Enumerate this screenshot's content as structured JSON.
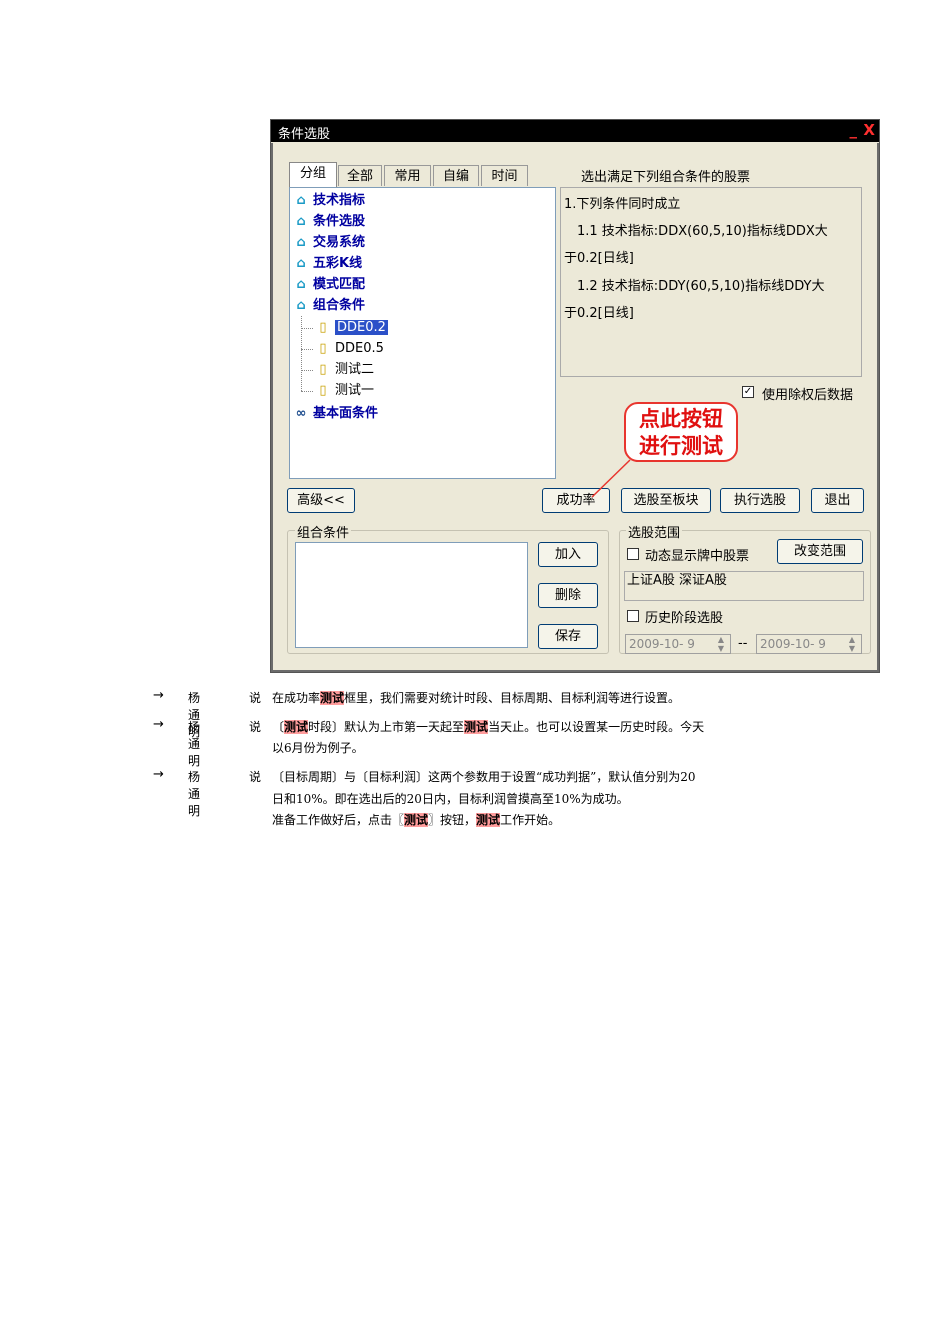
{
  "window": {
    "title": "条件选股",
    "minimize": "_",
    "close": "X"
  },
  "tabs": [
    "分组",
    "全部",
    "常用",
    "自编",
    "时间"
  ],
  "tree": {
    "roots": [
      "技术指标",
      "条件选股",
      "交易系统",
      "五彩K线",
      "模式匹配",
      "组合条件"
    ],
    "children": [
      "DDE0.2",
      "DDE0.5",
      "测试二",
      "测试一"
    ],
    "last_root": "基本面条件"
  },
  "conditions": {
    "title": "选出满足下列组合条件的股票",
    "lines": [
      "1.下列条件同时成立",
      "1.1 技术指标:DDX(60,5,10)指标线DDX大",
      "于0.2[日线]",
      "1.2 技术指标:DDY(60,5,10)指标线DDY大",
      "于0.2[日线]"
    ]
  },
  "use_adjusted": {
    "label": "使用除权后数据",
    "checked": "✓"
  },
  "callout": {
    "line1": "点此按钮",
    "line2": "进行测试"
  },
  "buttons": {
    "advanced": "高级<<",
    "success_rate": "成功率",
    "to_block": "选股至板块",
    "execute": "执行选股",
    "exit": "退出",
    "add": "加入",
    "delete": "删除",
    "save": "保存",
    "change_range": "改变范围"
  },
  "combo_group": {
    "legend": "组合条件"
  },
  "range_group": {
    "legend": "选股范围",
    "dynamic_label": "动态显示牌中股票",
    "scope": "上证A股 深证A股",
    "history_label": "历史阶段选股",
    "date_from": "2009-10- 9",
    "date_sep": "--",
    "date_to": "2009-10- 9"
  },
  "notes": {
    "arrow": "→",
    "speaker": "杨通明",
    "say": "说",
    "n1": {
      "a": "在成功率",
      "b": "测试",
      "c": "框里，我们需要对统计时段、目标周期、目标利润等进行设置。"
    },
    "n2": {
      "a": "〔",
      "b": "测试",
      "c": "时段〕默认为上市第一天起至",
      "d": "测试",
      "e": "当天止。也可以设置某一历史时段。今天",
      "f": "以6月份为例子。"
    },
    "n3": {
      "l1": "〔目标周期〕与〔目标利润〕这两个参数用于设置“成功判据”，默认值分别为20",
      "l2": "日和10%。即在选出后的20日内，目标利润曾摸高至10%为成功。",
      "l3a": "准备工作做好后，点击〖",
      "l3b": "测试",
      "l3c": "〗按钮，",
      "l3d": "测试",
      "l3e": "工作开始。"
    }
  }
}
